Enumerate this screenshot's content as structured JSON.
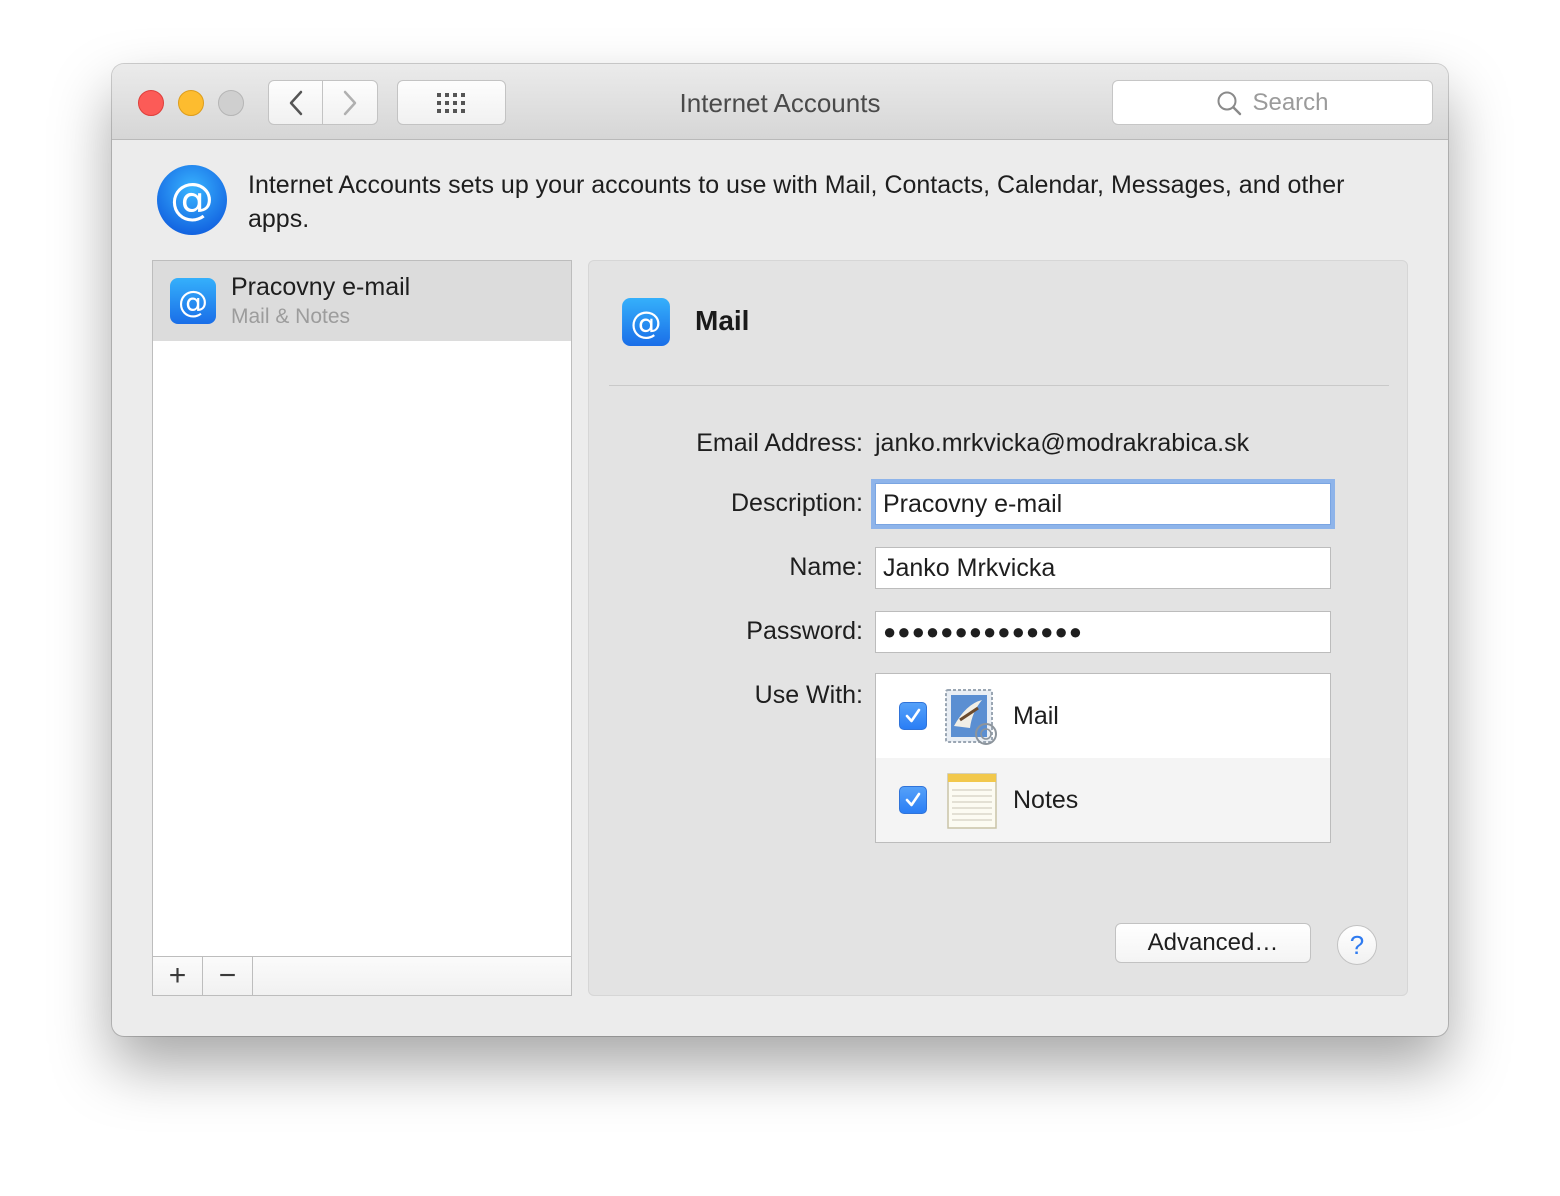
{
  "window": {
    "title": "Internet Accounts"
  },
  "toolbar": {
    "search_placeholder": "Search"
  },
  "intro": {
    "text": "Internet Accounts sets up your accounts to use with Mail, Contacts, Calendar, Messages, and other apps."
  },
  "accounts": [
    {
      "name": "Pracovny e-mail",
      "services": "Mail & Notes",
      "selected": true
    }
  ],
  "list_toolbar": {
    "add_label": "+",
    "remove_label": "−"
  },
  "detail": {
    "title": "Mail",
    "email_label": "Email Address:",
    "email_value": "janko.mrkvicka@modrakrabica.sk",
    "description_label": "Description:",
    "description_value": "Pracovny e-mail",
    "name_label": "Name:",
    "name_value": "Janko Mrkvicka",
    "password_label": "Password:",
    "password_value": "●●●●●●●●●●●●●●",
    "use_with_label": "Use With:",
    "use_with": [
      {
        "label": "Mail",
        "checked": true,
        "icon": "mail-app-icon"
      },
      {
        "label": "Notes",
        "checked": true,
        "icon": "notes-app-icon"
      }
    ],
    "advanced_label": "Advanced…",
    "help_label": "?"
  },
  "colors": {
    "accent": "#2a7ef5",
    "close": "#fc5b57",
    "minimize": "#fdbc2f"
  }
}
